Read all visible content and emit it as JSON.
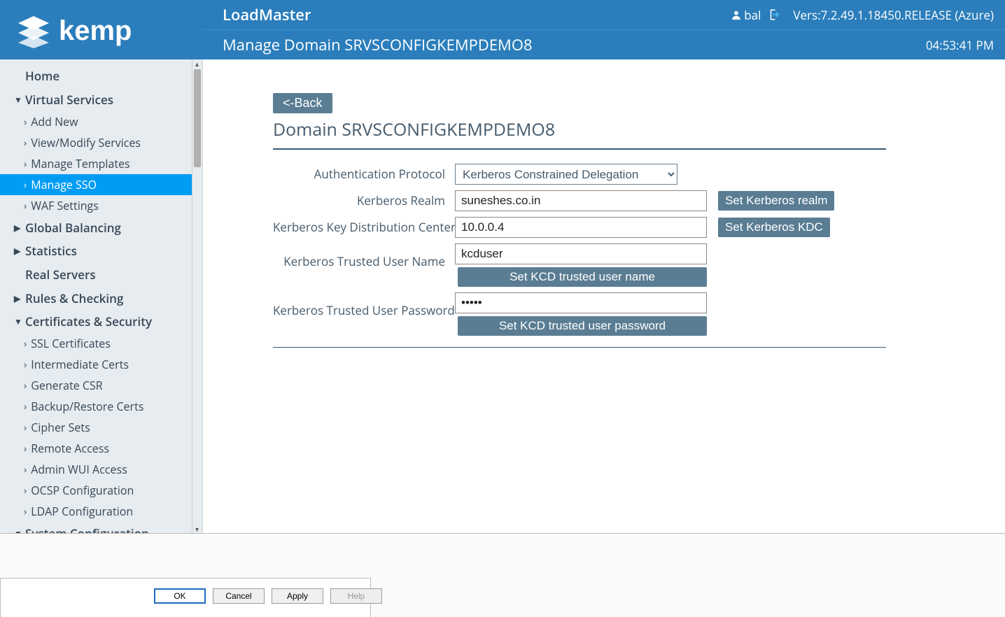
{
  "header": {
    "product": "LoadMaster",
    "user": "bal",
    "version": "Vers:7.2.49.1.18450.RELEASE (Azure)",
    "subtitle": "Manage Domain SRVSCONFIGKEMPDEMO8",
    "time": "04:53:41 PM"
  },
  "sidebar": {
    "home": "Home",
    "sections": [
      {
        "label": "Virtual Services",
        "expanded": true,
        "items": [
          "Add New",
          "View/Modify Services",
          "Manage Templates",
          "Manage SSO",
          "WAF Settings"
        ],
        "active": "Manage SSO"
      },
      {
        "label": "Global Balancing",
        "expanded": false,
        "items": []
      },
      {
        "label": "Statistics",
        "expanded": false,
        "items": []
      },
      {
        "label": "Real Servers",
        "plain": true
      },
      {
        "label": "Rules & Checking",
        "expanded": false,
        "items": []
      },
      {
        "label": "Certificates & Security",
        "expanded": true,
        "items": [
          "SSL Certificates",
          "Intermediate Certs",
          "Generate CSR",
          "Backup/Restore Certs",
          "Cipher Sets",
          "Remote Access",
          "Admin WUI Access",
          "OCSP Configuration",
          "LDAP Configuration"
        ]
      },
      {
        "label": "System Configuration",
        "expanded": true,
        "items": []
      }
    ]
  },
  "content": {
    "back": "<-Back",
    "title": "Domain SRVSCONFIGKEMPDEMO8",
    "labels": {
      "auth_protocol": "Authentication Protocol",
      "realm": "Kerberos Realm",
      "kdc": "Kerberos Key Distribution Center",
      "trusted_user": "Kerberos Trusted User Name",
      "trusted_pwd": "Kerberos Trusted User Password"
    },
    "values": {
      "auth_protocol": "Kerberos Constrained Delegation",
      "realm": "suneshes.co.in",
      "kdc": "10.0.0.4",
      "trusted_user": "kcduser",
      "trusted_pwd": "•••••"
    },
    "buttons": {
      "set_realm": "Set Kerberos realm",
      "set_kdc": "Set Kerberos KDC",
      "set_user": "Set KCD trusted user name",
      "set_pwd": "Set KCD trusted user password"
    }
  },
  "dialog": {
    "ok": "OK",
    "cancel": "Cancel",
    "apply": "Apply",
    "help": "Help"
  }
}
